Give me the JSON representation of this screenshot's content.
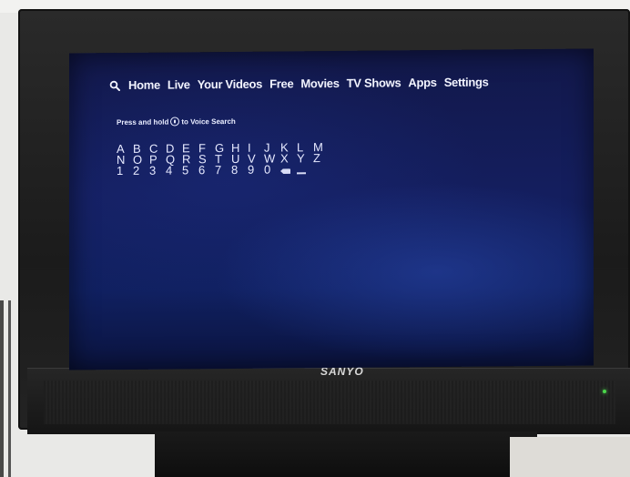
{
  "nav": {
    "search_icon": "search-icon",
    "tabs": [
      "Home",
      "Live",
      "Your Videos",
      "Free",
      "Movies",
      "TV Shows",
      "Apps",
      "Settings"
    ]
  },
  "voice_hint": {
    "prefix": "Press and hold",
    "icon": "mic-icon",
    "suffix": "to Voice Search"
  },
  "keyboard": {
    "row1": [
      "A",
      "B",
      "C",
      "D",
      "E",
      "F",
      "G",
      "H",
      "I",
      "J",
      "K",
      "L",
      "M"
    ],
    "row2": [
      "N",
      "O",
      "P",
      "Q",
      "R",
      "S",
      "T",
      "U",
      "V",
      "W",
      "X",
      "Y",
      "Z"
    ],
    "row3": [
      "1",
      "2",
      "3",
      "4",
      "5",
      "6",
      "7",
      "8",
      "9",
      "0"
    ],
    "special_keys": [
      "backspace-icon",
      "space-icon"
    ]
  },
  "tv": {
    "brand": "SANYO",
    "led_color": "#4bd64b"
  },
  "colors": {
    "screen_bg": "#141e5e",
    "text": "#f2f4ff"
  }
}
